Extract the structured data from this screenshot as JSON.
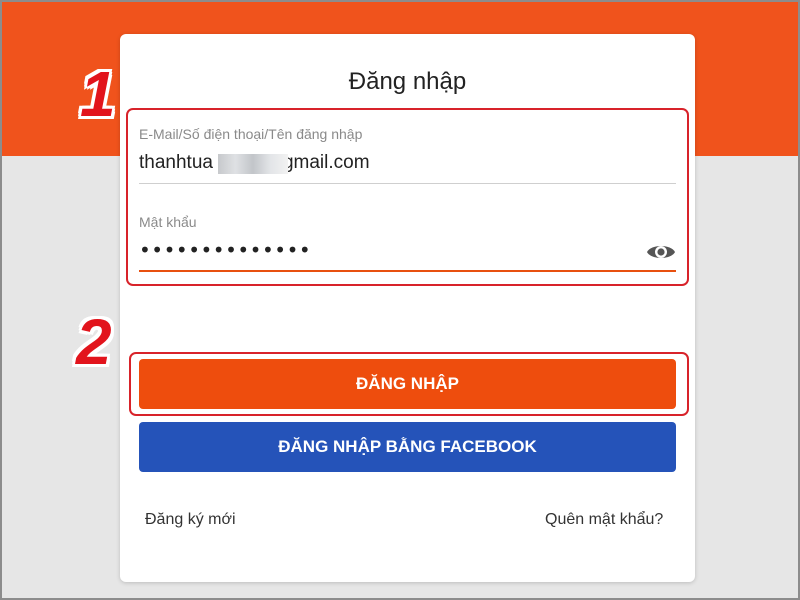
{
  "login_form": {
    "title": "Đăng nhập",
    "email": {
      "label": "E-Mail/Số điện thoại/Tên đăng nhập",
      "value": "thanhtua",
      "value_suffix": "gmail.com"
    },
    "password": {
      "label": "Mật khẩu",
      "value": "••••••••••••••",
      "toggle_icon": "eye-icon"
    },
    "login_button": "ĐĂNG NHẬP",
    "facebook_button": "ĐĂNG NHẬP BẰNG FACEBOOK",
    "signup_link": "Đăng ký mới",
    "forgot_link": "Quên mật khẩu?"
  },
  "annotations": {
    "step_1": "1",
    "step_2": "2"
  },
  "colors": {
    "brand_orange": "#f0531c",
    "button_orange": "#ee4d0d",
    "facebook_blue": "#2553b9",
    "highlight_red": "#d8232a"
  }
}
